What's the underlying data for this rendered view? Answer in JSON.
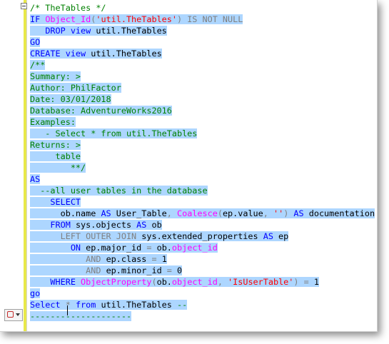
{
  "editor": {
    "smart_tag_icon": "comment-icon",
    "lines": [
      {
        "sel": false,
        "tokens": [
          {
            "c": "cm",
            "t": "/* TheTables */"
          }
        ]
      },
      {
        "sel": true,
        "tokens": [
          {
            "c": "kw",
            "t": "IF "
          },
          {
            "c": "fn",
            "t": "Object_Id"
          },
          {
            "c": "gr",
            "t": "("
          },
          {
            "c": "str",
            "t": "'util.TheTables'"
          },
          {
            "c": "gr",
            "t": ") IS NOT NULL"
          }
        ]
      },
      {
        "sel": true,
        "tokens": [
          {
            "c": "tx",
            "t": "   "
          },
          {
            "c": "kw",
            "t": "DROP view "
          },
          {
            "c": "tx",
            "t": "util.TheTables"
          }
        ]
      },
      {
        "sel": true,
        "tokens": [
          {
            "c": "kw",
            "t": "GO"
          }
        ]
      },
      {
        "sel": true,
        "tokens": [
          {
            "c": "kw",
            "t": "CREATE view "
          },
          {
            "c": "tx",
            "t": "util.TheTables"
          }
        ]
      },
      {
        "sel": true,
        "tokens": [
          {
            "c": "cm",
            "t": "/**"
          }
        ]
      },
      {
        "sel": true,
        "tokens": [
          {
            "c": "cm",
            "t": "Summary: >"
          }
        ]
      },
      {
        "sel": true,
        "tokens": [
          {
            "c": "cm",
            "t": "Author: PhilFactor"
          }
        ]
      },
      {
        "sel": true,
        "tokens": [
          {
            "c": "cm",
            "t": "Date: 03/01/2018"
          }
        ]
      },
      {
        "sel": true,
        "tokens": [
          {
            "c": "cm",
            "t": "Database: AdventureWorks2016"
          }
        ]
      },
      {
        "sel": true,
        "tokens": [
          {
            "c": "cm",
            "t": "Examples:"
          }
        ]
      },
      {
        "sel": true,
        "tokens": [
          {
            "c": "cm",
            "t": "   - Select * from util.TheTables"
          }
        ]
      },
      {
        "sel": true,
        "tokens": [
          {
            "c": "cm",
            "t": "Returns: >"
          }
        ]
      },
      {
        "sel": true,
        "tokens": [
          {
            "c": "cm",
            "t": "     table"
          }
        ]
      },
      {
        "sel": true,
        "tokens": [
          {
            "c": "cm",
            "t": "        **/"
          }
        ]
      },
      {
        "sel": true,
        "tokens": [
          {
            "c": "kw",
            "t": "AS"
          }
        ]
      },
      {
        "sel": true,
        "tokens": [
          {
            "c": "cm",
            "t": "  --all user tables in the database"
          }
        ]
      },
      {
        "sel": true,
        "tokens": [
          {
            "c": "tx",
            "t": "    "
          },
          {
            "c": "kw",
            "t": "SELECT"
          }
        ]
      },
      {
        "sel": true,
        "tokens": [
          {
            "c": "tx",
            "t": "      ob.name "
          },
          {
            "c": "kw",
            "t": "AS "
          },
          {
            "c": "tx",
            "t": "User_Table"
          },
          {
            "c": "gr",
            "t": ", "
          },
          {
            "c": "fn",
            "t": "Coalesce"
          },
          {
            "c": "gr",
            "t": "("
          },
          {
            "c": "tx",
            "t": "ep.value"
          },
          {
            "c": "gr",
            "t": ", "
          },
          {
            "c": "str",
            "t": "''"
          },
          {
            "c": "gr",
            "t": ") "
          },
          {
            "c": "kw",
            "t": "AS "
          },
          {
            "c": "tx",
            "t": "documentation"
          }
        ]
      },
      {
        "sel": true,
        "tokens": [
          {
            "c": "tx",
            "t": "    "
          },
          {
            "c": "kw",
            "t": "FROM "
          },
          {
            "c": "tx",
            "t": "sys.objects "
          },
          {
            "c": "kw",
            "t": "AS "
          },
          {
            "c": "tx",
            "t": "ob"
          }
        ]
      },
      {
        "sel": true,
        "tokens": [
          {
            "c": "tx",
            "t": "      "
          },
          {
            "c": "gr",
            "t": "LEFT OUTER JOIN "
          },
          {
            "c": "tx",
            "t": "sys.extended_properties "
          },
          {
            "c": "kw",
            "t": "AS "
          },
          {
            "c": "tx",
            "t": "ep"
          }
        ]
      },
      {
        "sel": true,
        "tokens": [
          {
            "c": "tx",
            "t": "        "
          },
          {
            "c": "kw",
            "t": "ON "
          },
          {
            "c": "tx",
            "t": "ep.major_id "
          },
          {
            "c": "gr",
            "t": "= "
          },
          {
            "c": "tx",
            "t": "ob."
          },
          {
            "c": "fn",
            "t": "object_id"
          }
        ]
      },
      {
        "sel": true,
        "tokens": [
          {
            "c": "tx",
            "t": "           "
          },
          {
            "c": "gr",
            "t": "AND "
          },
          {
            "c": "tx",
            "t": "ep.class "
          },
          {
            "c": "gr",
            "t": "= "
          },
          {
            "c": "tx",
            "t": "1"
          }
        ]
      },
      {
        "sel": true,
        "tokens": [
          {
            "c": "tx",
            "t": "           "
          },
          {
            "c": "gr",
            "t": "AND "
          },
          {
            "c": "tx",
            "t": "ep.minor_id "
          },
          {
            "c": "gr",
            "t": "= "
          },
          {
            "c": "tx",
            "t": "0"
          }
        ]
      },
      {
        "sel": true,
        "tokens": [
          {
            "c": "tx",
            "t": "    "
          },
          {
            "c": "kw",
            "t": "WHERE "
          },
          {
            "c": "fn",
            "t": "ObjectProperty"
          },
          {
            "c": "gr",
            "t": "("
          },
          {
            "c": "tx",
            "t": "ob."
          },
          {
            "c": "fn",
            "t": "object_id"
          },
          {
            "c": "gr",
            "t": ", "
          },
          {
            "c": "str",
            "t": "'IsUserTable'"
          },
          {
            "c": "gr",
            "t": ") = "
          },
          {
            "c": "tx",
            "t": "1"
          }
        ]
      },
      {
        "sel": true,
        "tokens": [
          {
            "c": "kw",
            "t": "go"
          }
        ]
      },
      {
        "sel": true,
        "tokens": [
          {
            "c": "kw",
            "t": "Select "
          },
          {
            "c": "gr",
            "t": "* "
          },
          {
            "c": "kw",
            "t": "from "
          },
          {
            "c": "tx",
            "t": "util.TheTables "
          },
          {
            "c": "cm",
            "t": "--"
          }
        ]
      },
      {
        "sel": true,
        "tokens": [
          {
            "c": "cm",
            "t": "--------------------"
          }
        ]
      }
    ]
  }
}
